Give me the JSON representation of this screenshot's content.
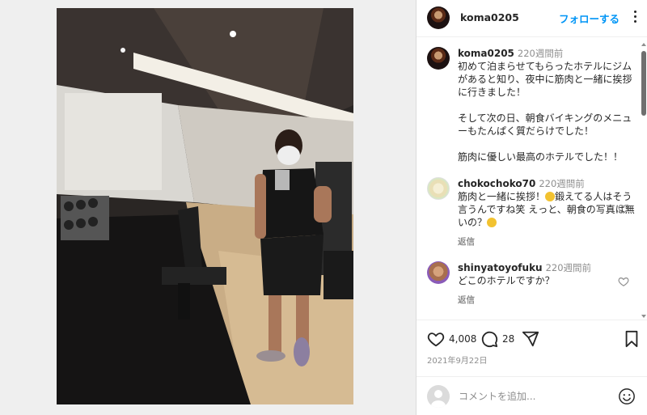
{
  "post": {
    "owner": "koma0205",
    "follow_label": "フォローする",
    "caption_time": "220週間前",
    "caption_paragraphs": [
      "初めて泊まらせてもらったホテルにジムがあると知り、夜中に筋肉と一緒に挨拶に行きました！",
      "そして次の日、朝食バイキングのメニューもたんぱく質だらけでした！",
      "筋肉に優しい最高のホテルでした！！"
    ],
    "likes": "4,008",
    "comment_count": "28",
    "date": "2021年9月22日"
  },
  "comments": [
    {
      "user": "chokochoko70",
      "time": "220週間前",
      "text_a": "筋肉と一緒に挨拶！",
      "text_b": "鍛えてる人はそう言うんですね笑 えっと、朝食の写真は無いの？",
      "reply_label": "返信"
    },
    {
      "user": "shinyatoyofuku",
      "time": "220週間前",
      "text": "どこのホテルですか？",
      "reply_label": "返信"
    }
  ],
  "composer": {
    "placeholder": "コメントを追加..."
  },
  "icons": {
    "more": "more-options-icon",
    "like": "heart-icon",
    "comment": "comment-bubble-icon",
    "share": "paper-plane-icon",
    "save": "bookmark-icon",
    "emoji": "smiley-icon"
  },
  "colors": {
    "accent": "#0095f6",
    "muted": "#8e8e8e",
    "text": "#262626"
  }
}
